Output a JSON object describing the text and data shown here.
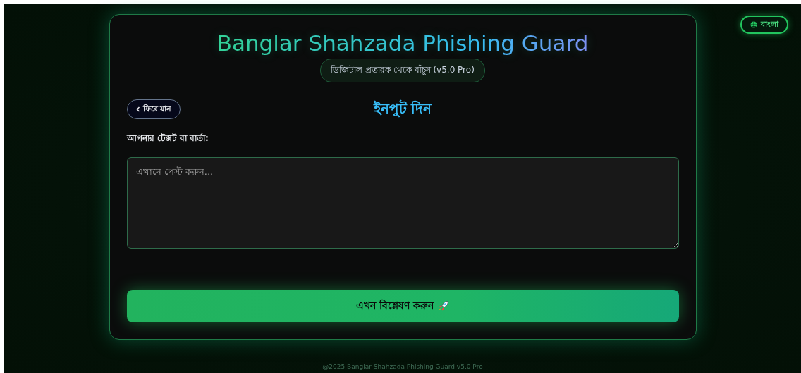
{
  "language_button": {
    "label": "বাংলা"
  },
  "header": {
    "title": "Banglar Shahzada Phishing Guard",
    "subtitle": "ডিজিটাল প্রতারক থেকে বাঁচুন (v5.0 Pro)"
  },
  "back_button": {
    "label": "ফিরে যান"
  },
  "section_title": "ইনপুট দিন",
  "input": {
    "label": "আপনার টেক্সট বা বার্তা:",
    "placeholder": "এখানে পেস্ট করুন..."
  },
  "submit_button": {
    "label": "এখন বিশ্লেষণ করুন"
  },
  "footer": "@2025 Banglar Shahzada Phishing Guard v5.0 Pro"
}
